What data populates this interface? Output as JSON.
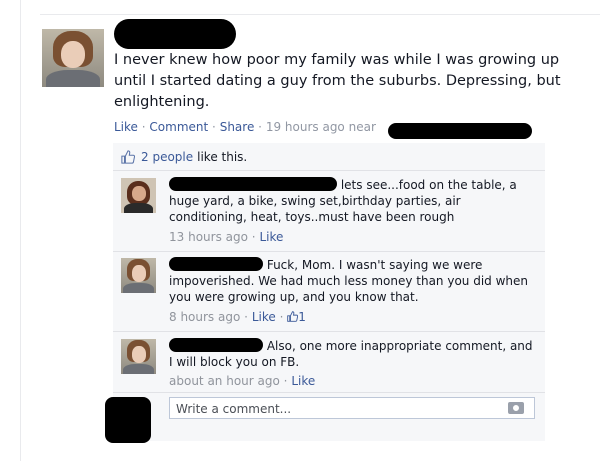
{
  "post": {
    "author_redacted": true,
    "text": "I never knew how poor my family was while I was growing up until I started dating a guy from the suburbs. Depressing, but enlightening.",
    "actions": {
      "like": "Like",
      "comment": "Comment",
      "share": "Share"
    },
    "timestamp": "19 hours ago",
    "location_prefix": "near"
  },
  "ufi": {
    "likes_count": "2 people",
    "likes_suffix": "like this.",
    "comments": [
      {
        "author_redacted": true,
        "text": "lets see...food on the table, a huge yard, a bike, swing set,birthday parties, air conditioning, heat, toys..must have been rough",
        "timestamp": "13 hours ago",
        "like_label": "Like"
      },
      {
        "author_redacted": true,
        "text": "Fuck, Mom. I wasn't saying we were impoverished. We had much less money than you did when you were growing up, and you know that.",
        "timestamp": "8 hours ago",
        "like_label": "Like",
        "like_count": "1"
      },
      {
        "author_redacted": true,
        "text": "Also, one more inappropriate comment, and I will block you on FB.",
        "timestamp": "about an hour ago",
        "like_label": "Like"
      }
    ],
    "comment_input_placeholder": "Write a comment...",
    "separator": "·"
  },
  "icons": [
    "thumbs-up-icon",
    "camera-icon"
  ],
  "colors": {
    "link": "#3b5998",
    "meta": "#9197a3",
    "ufi_bg": "#f6f7f9"
  }
}
